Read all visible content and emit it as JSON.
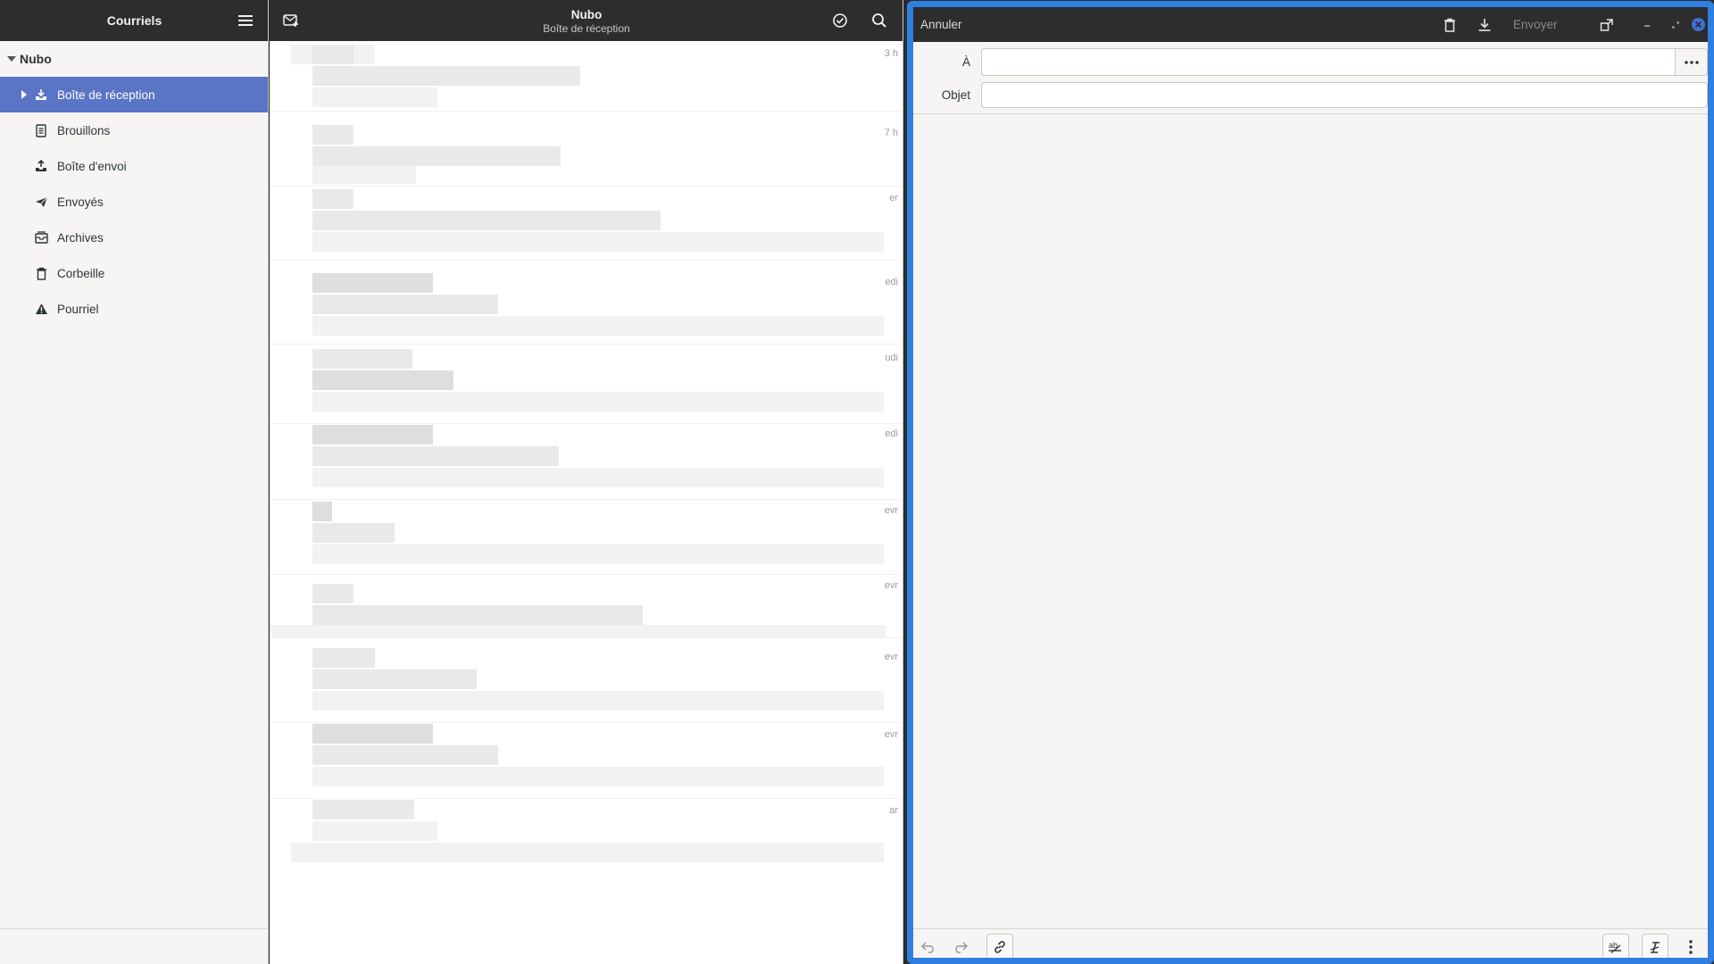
{
  "sidebar": {
    "title": "Courriels",
    "menu_icon": "hamburger-menu-icon",
    "account": "Nubo",
    "folders": [
      {
        "label": "Boîte de réception",
        "icon": "inbox-icon",
        "selected": true
      },
      {
        "label": "Brouillons",
        "icon": "drafts-icon",
        "selected": false
      },
      {
        "label": "Boîte d'envoi",
        "icon": "outbox-icon",
        "selected": false
      },
      {
        "label": "Envoyés",
        "icon": "sent-icon",
        "selected": false
      },
      {
        "label": "Archives",
        "icon": "archive-icon",
        "selected": false
      },
      {
        "label": "Corbeille",
        "icon": "trash-icon",
        "selected": false
      },
      {
        "label": "Pourriel",
        "icon": "warning-icon",
        "selected": false
      }
    ]
  },
  "message_list": {
    "title": "Nubo",
    "subtitle": "Boîte de réception",
    "date_fragments": [
      "3 h",
      "7 h",
      "er",
      "edi",
      "udi",
      "edi",
      "evr",
      "evr",
      "evr",
      "evr",
      "ar"
    ]
  },
  "composer": {
    "cancel_label": "Annuler",
    "send_label": "Envoyer",
    "to_label": "À",
    "to_value": "",
    "subject_label": "Objet",
    "subject_value": "",
    "body_value": ""
  },
  "colors": {
    "header_bg": "#2d2d2d",
    "selection": "#5a74c6",
    "focus_border": "#2f7fe0"
  }
}
